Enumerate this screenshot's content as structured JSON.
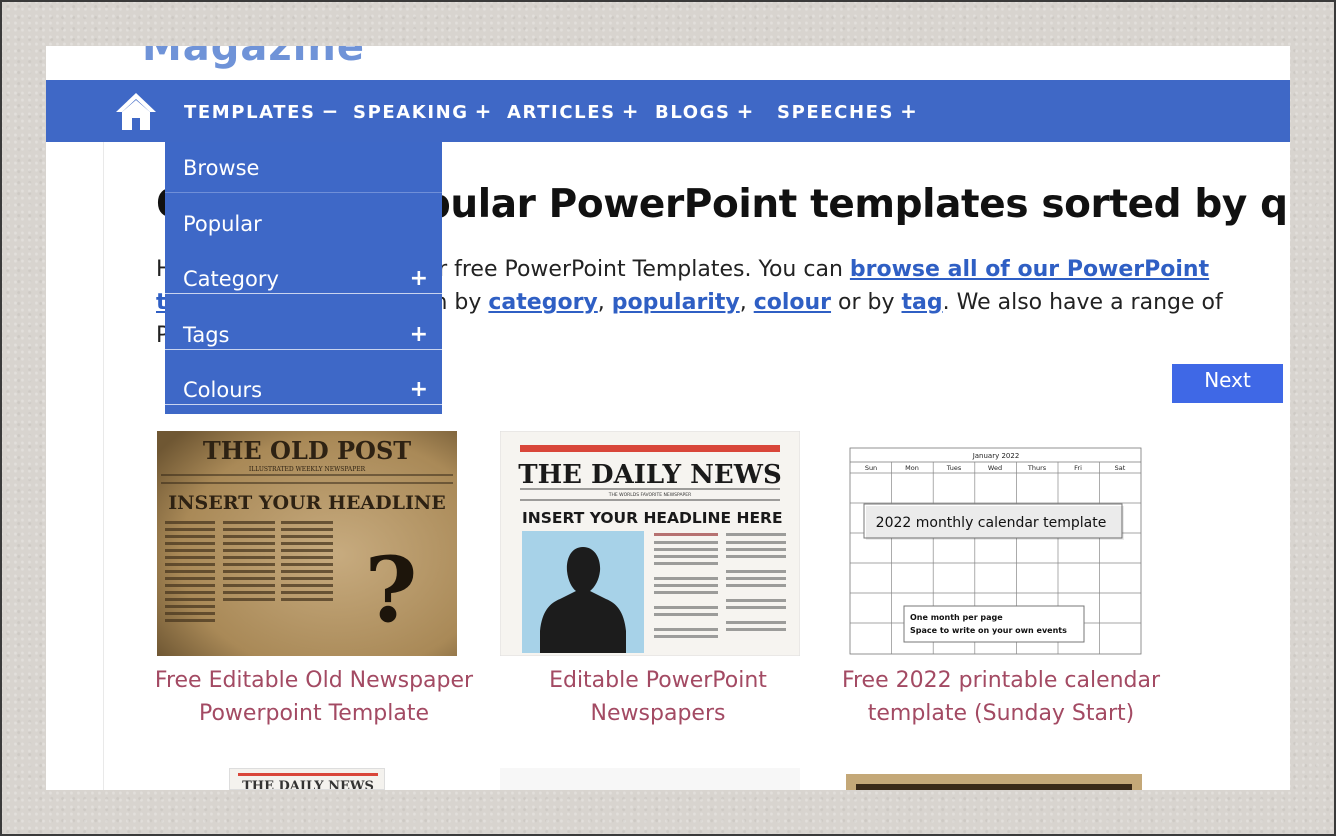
{
  "logo": {
    "text": "Magazine"
  },
  "nav": {
    "home_label": "Home",
    "items": [
      {
        "label": "TEMPLATES",
        "sign": "−"
      },
      {
        "label": "SPEAKING",
        "sign": "+"
      },
      {
        "label": "ARTICLES",
        "sign": "+"
      },
      {
        "label": "BLOGS",
        "sign": "+"
      },
      {
        "label": "SPEECHES",
        "sign": "+"
      }
    ]
  },
  "dropdown": {
    "items": [
      {
        "label": "Browse",
        "has_plus": false
      },
      {
        "label": "Popular",
        "has_plus": false
      },
      {
        "label": "Category",
        "has_plus": true,
        "plus": "+"
      },
      {
        "label": "Tags",
        "has_plus": true,
        "plus": "+"
      },
      {
        "label": "Colours",
        "has_plus": true,
        "plus": "+"
      }
    ]
  },
  "main": {
    "headline": "Our most popular PowerPoint templates sorted by quality",
    "intro": {
      "t1": "Here are our most popular free PowerPoint Templates. You can ",
      "link1": "browse all of our PowerPoint templates",
      "t2": " or select them by ",
      "link2": "category",
      "t3": ", ",
      "link3": "popularity",
      "t4": ", ",
      "link4": "colour",
      "t5": " or by ",
      "link5": "tag",
      "t6": ". We also have a range of PowerPoint backgrounds."
    },
    "next_label": "Next"
  },
  "cards": [
    {
      "title": "Free Editable Old Newspaper Powerpoint Template",
      "thumb": {
        "masthead": "THE OLD POST",
        "sub": "ILLUSTRATED WEEKLY NEWSPAPER",
        "headline": "INSERT YOUR HEADLINE",
        "mark": "?"
      }
    },
    {
      "title": "Editable PowerPoint Newspapers",
      "thumb": {
        "masthead": "THE DAILY NEWS",
        "sub": "THE WORLDS FAVORITE NEWSPAPER",
        "headline": "INSERT YOUR HEADLINE HERE"
      }
    },
    {
      "title": "Free 2022 printable calendar template (Sunday Start)",
      "thumb": {
        "month": "January 2022",
        "days": [
          "Sun",
          "Mon",
          "Tues",
          "Wed",
          "Thurs",
          "Fri",
          "Sat"
        ],
        "banner": "2022 monthly calendar template",
        "note1": "One month per page",
        "note2": "Space to write on your own events"
      }
    }
  ],
  "peek": {
    "masthead": "THE DAILY NEWS"
  },
  "colors": {
    "nav_bg": "#3f68c6",
    "link": "#2f5fc4",
    "card_title": "#a34a63",
    "button": "#3f68e6"
  },
  "icons": {
    "home": "house-icon",
    "plus": "plus-icon",
    "minus": "minus-icon"
  }
}
